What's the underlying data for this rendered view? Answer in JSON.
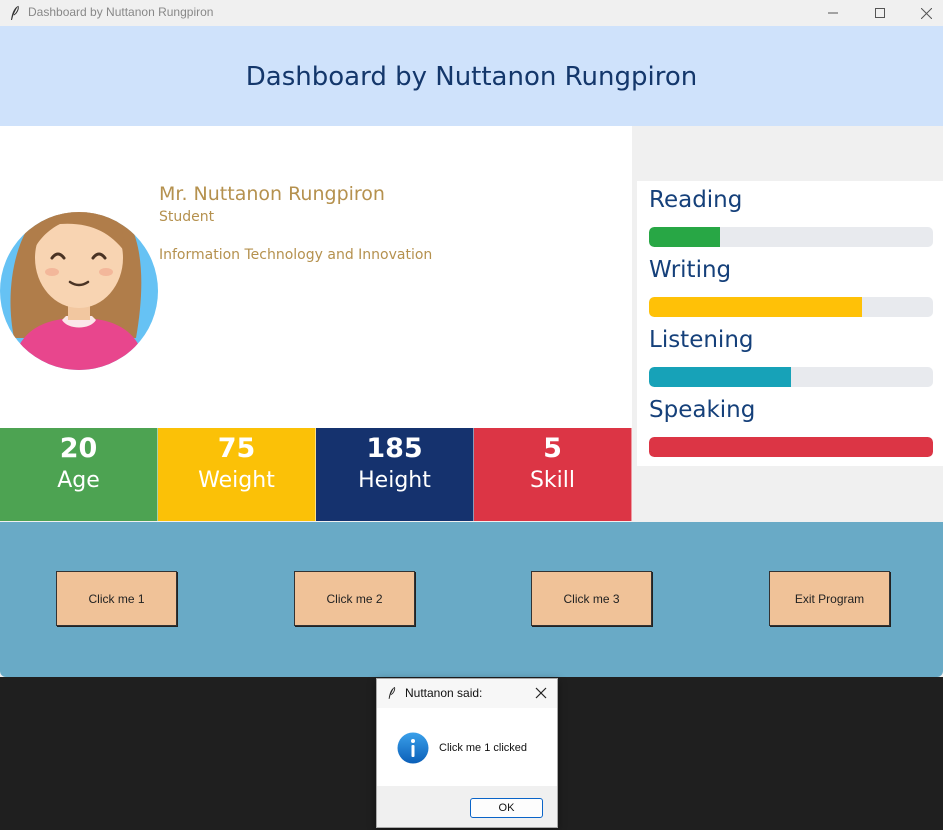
{
  "window": {
    "title": "Dashboard by Nuttanon Rungpiron"
  },
  "header": {
    "title": "Dashboard by Nuttanon Rungpiron"
  },
  "profile": {
    "name": "Mr. Nuttanon Rungpiron",
    "role": "Student",
    "department": "Information Technology and Innovation"
  },
  "stats": [
    {
      "value": "20",
      "label": "Age",
      "color": "#4da352"
    },
    {
      "value": "75",
      "label": "Weight",
      "color": "#fbc107"
    },
    {
      "value": "185",
      "label": "Height",
      "color": "#15326e"
    },
    {
      "value": "5",
      "label": "Skill",
      "color": "#dc3545"
    }
  ],
  "skills": [
    {
      "label": "Reading",
      "level": 0.25,
      "color": "#28a745"
    },
    {
      "label": "Writing",
      "level": 0.75,
      "color": "#ffc107"
    },
    {
      "label": "Listening",
      "level": 0.5,
      "color": "#17a2b8"
    },
    {
      "label": "Speaking",
      "level": 1.0,
      "color": "#dc3545"
    }
  ],
  "buttons": {
    "b1": "Click me 1",
    "b2": "Click me 2",
    "b3": "Click me 3",
    "exit": "Exit Program"
  },
  "dialog": {
    "title": "Nuttanon said:",
    "message": "Click me 1 clicked",
    "ok": "OK"
  },
  "colors": {
    "header_bg": "#cfe2fb",
    "footer_bg": "#69aac6",
    "button_bg": "#f0c298",
    "text_brown": "#b5914e",
    "navy": "#14376b"
  }
}
